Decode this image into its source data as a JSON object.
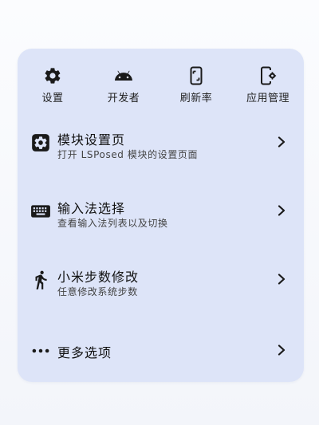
{
  "quick_actions": [
    {
      "label": "设置",
      "icon": "gear-icon"
    },
    {
      "label": "开发者",
      "icon": "android-icon"
    },
    {
      "label": "刷新率",
      "icon": "phone-refresh-icon"
    },
    {
      "label": "应用管理",
      "icon": "phone-settings-icon"
    }
  ],
  "menu_items": [
    {
      "title": "模块设置页",
      "subtitle": "打开 LSPosed 模块的设置页面",
      "icon": "module-settings-icon"
    },
    {
      "title": "输入法选择",
      "subtitle": "查看输入法列表以及切换",
      "icon": "keyboard-icon"
    },
    {
      "title": "小米步数修改",
      "subtitle": "任意修改系统步数",
      "icon": "walking-icon"
    },
    {
      "title": "更多选项",
      "subtitle": "",
      "icon": "more-dots-icon"
    }
  ],
  "colors": {
    "card_background": "#dde4f8",
    "page_background": "#f6f7fb",
    "icon_color": "#1a1a1a"
  }
}
